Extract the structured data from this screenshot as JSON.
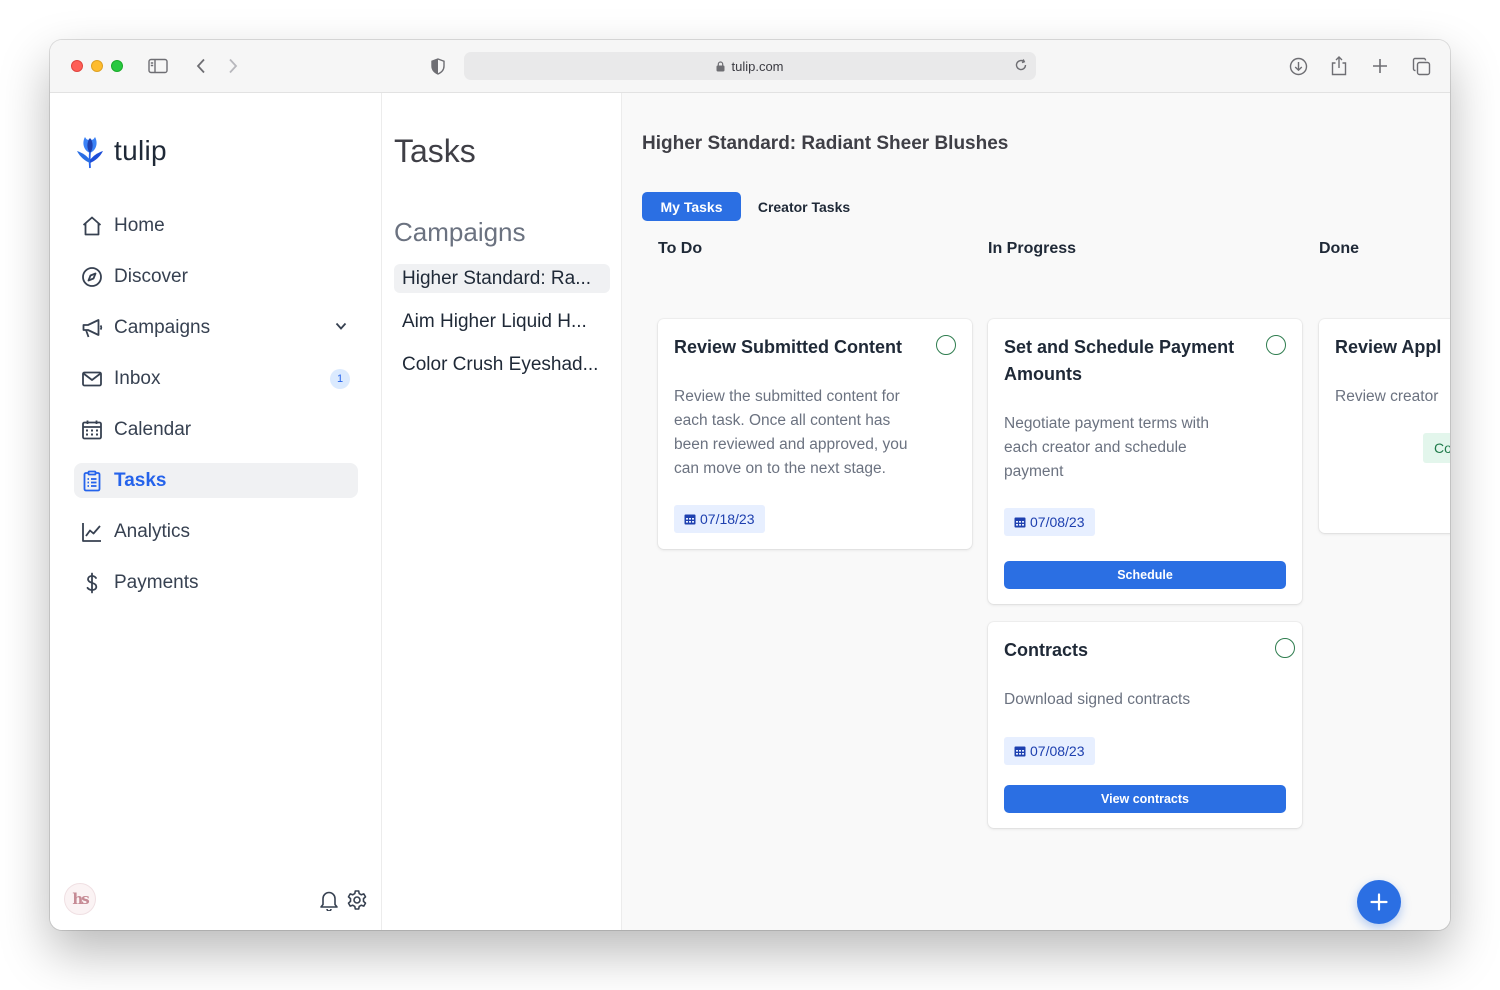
{
  "browser": {
    "url": "tulip.com"
  },
  "app": {
    "brand": "tulip",
    "accent_color": "#2b6fe3"
  },
  "sidebar": {
    "items": [
      {
        "label": "Home",
        "icon": "home-icon"
      },
      {
        "label": "Discover",
        "icon": "compass-icon"
      },
      {
        "label": "Campaigns",
        "icon": "megaphone-icon"
      },
      {
        "label": "Inbox",
        "icon": "mail-icon",
        "badge": "1"
      },
      {
        "label": "Calendar",
        "icon": "calendar-icon"
      },
      {
        "label": "Tasks",
        "icon": "clipboard-icon",
        "active": true
      },
      {
        "label": "Analytics",
        "icon": "chart-line-icon"
      },
      {
        "label": "Payments",
        "icon": "dollar-icon"
      }
    ],
    "avatar_initials": "hs"
  },
  "middle": {
    "title": "Tasks",
    "subtitle": "Campaigns",
    "campaigns": [
      "Higher Standard: Ra...",
      "Aim Higher Liquid H...",
      "Color Crush Eyeshad..."
    ]
  },
  "board": {
    "title": "Higher Standard: Radiant Sheer Blushes",
    "tabs": [
      "My Tasks",
      "Creator Tasks"
    ],
    "columns": [
      "To Do",
      "In Progress",
      "Done"
    ],
    "cards": {
      "todo_0": {
        "title": "Review Submitted Content",
        "desc_lines": [
          "Review the submitted content for",
          "each task. Once all content has",
          "been reviewed and approved, you",
          "can move on to the next stage."
        ],
        "date": "07/18/23"
      },
      "progress_0": {
        "title_lines": [
          "Set and Schedule Payment",
          "Amounts"
        ],
        "desc_lines": [
          "Negotiate payment terms with",
          "each creator and schedule",
          "payment"
        ],
        "date": "07/08/23",
        "button": "Schedule"
      },
      "progress_1": {
        "title": "Contracts",
        "desc_lines": [
          "Download signed contracts"
        ],
        "date": "07/08/23",
        "button": "View contracts"
      },
      "done_0": {
        "title": "Review Appl",
        "desc": "Review creator",
        "chip": "Co"
      }
    }
  }
}
